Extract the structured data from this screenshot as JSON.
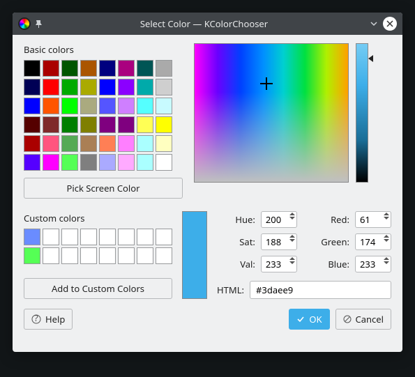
{
  "titlebar": {
    "title": "Select Color — KColorChooser"
  },
  "sections": {
    "basic_label": "Basic colors",
    "custom_label": "Custom colors"
  },
  "buttons": {
    "pick_screen": "Pick Screen Color",
    "add_custom": "Add to Custom Colors",
    "help": "Help",
    "ok": "OK",
    "cancel": "Cancel"
  },
  "basic_colors": [
    "#000000",
    "#aa0000",
    "#005500",
    "#aa5500",
    "#00007f",
    "#aa007f",
    "#005555",
    "#aaaaaa",
    "#000055",
    "#ff0000",
    "#00aa00",
    "#aaaa00",
    "#0000ff",
    "#8b00ff",
    "#00aaaa",
    "#cfcfcf",
    "#0000ff",
    "#ff5500",
    "#00ff00",
    "#aaaa7f",
    "#5555ff",
    "#cf7fff",
    "#55ffff",
    "#c8faff",
    "#550000",
    "#7f2a2a",
    "#007f00",
    "#7f7f00",
    "#7f007f",
    "#7f007f",
    "#ffff55",
    "#ffff00",
    "#aa0000",
    "#ff557f",
    "#55aa55",
    "#aa7f55",
    "#ff7f55",
    "#ff7fff",
    "#aaffff",
    "#ffffc0",
    "#5500ff",
    "#ff00ff",
    "#55ff55",
    "#7f7f7f",
    "#aaaaff",
    "#ffaaff",
    "#aaffff",
    "#ffffff"
  ],
  "custom_colors": [
    "#6a8cff",
    "#ffffff",
    "#ffffff",
    "#ffffff",
    "#ffffff",
    "#ffffff",
    "#ffffff",
    "#ffffff",
    "#55ff55",
    "#ffffff",
    "#ffffff",
    "#ffffff",
    "#ffffff",
    "#ffffff",
    "#ffffff",
    "#ffffff"
  ],
  "fields": {
    "hue_label": "Hue:",
    "hue": "200",
    "sat_label": "Sat:",
    "sat": "188",
    "val_label": "Val:",
    "val": "233",
    "red_label": "Red:",
    "red": "61",
    "green_label": "Green:",
    "green": "174",
    "blue_label": "Blue:",
    "blue": "233",
    "html_label": "HTML:",
    "html": "#3daee9"
  },
  "current_color": "#3daee9"
}
